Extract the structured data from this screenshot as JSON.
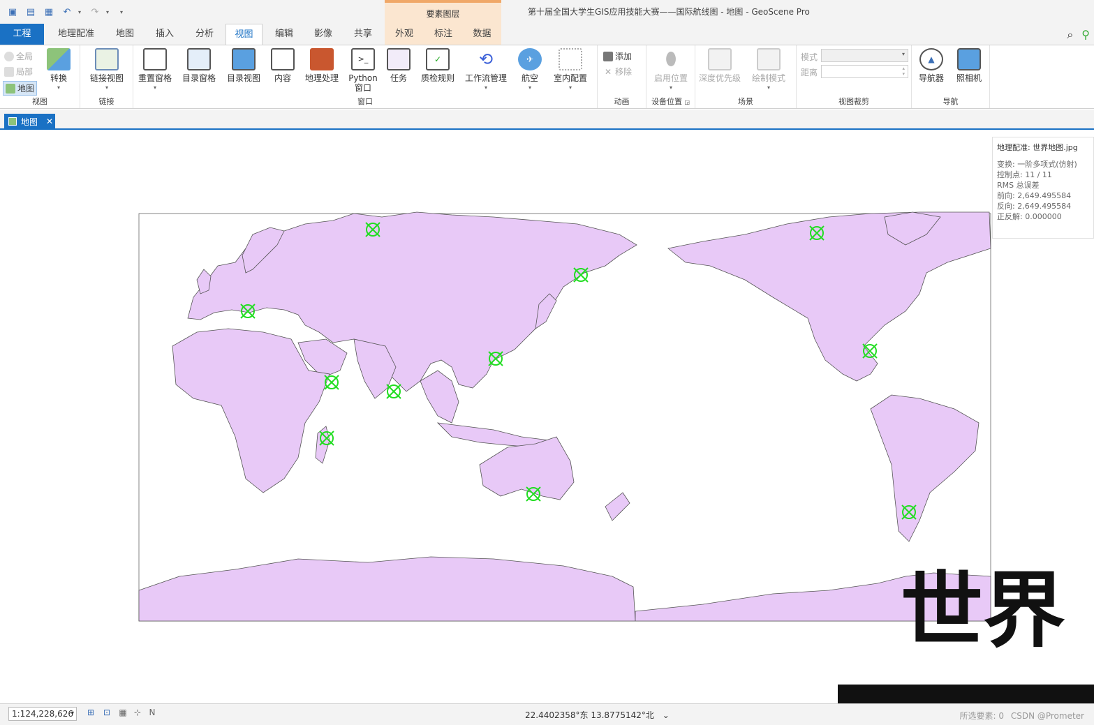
{
  "window": {
    "title": "第十届全国大学生GIS应用技能大赛——国际航线图 - 地图 - GeoScene Pro",
    "contextual_tab_group": "要素图层"
  },
  "quick_access": [
    "new-project-icon",
    "open-project-icon",
    "save-project-icon",
    "undo-icon",
    "redo-icon",
    "customize-icon"
  ],
  "tabs": [
    {
      "label": "工程"
    },
    {
      "label": "地理配准"
    },
    {
      "label": "地图"
    },
    {
      "label": "插入"
    },
    {
      "label": "分析"
    },
    {
      "label": "视图"
    },
    {
      "label": "编辑"
    },
    {
      "label": "影像"
    },
    {
      "label": "共享"
    },
    {
      "label": "外观"
    },
    {
      "label": "标注"
    },
    {
      "label": "数据"
    }
  ],
  "ribbon": {
    "view_group": {
      "label": "视图",
      "global": "全局",
      "local": "局部",
      "map": "地图",
      "convert": "转换"
    },
    "link_group": {
      "label": "链接",
      "link_views": "链接视图"
    },
    "windows_group": {
      "label": "窗口",
      "buttons": [
        "重置窗格",
        "目录窗格",
        "目录视图",
        "内容",
        "地理处理",
        "Python",
        "任务",
        "质检规则",
        "工作流管理",
        "航空",
        "室内配置"
      ],
      "python_sub": "窗口"
    },
    "animation_group": {
      "label": "动画",
      "add": "添加",
      "remove": "移除"
    },
    "device_group": {
      "label": "设备位置",
      "enable_location": "启用位置"
    },
    "scene_group": {
      "label": "场景",
      "depth_priority": "深度优先级",
      "draw_mode": "绘制模式"
    },
    "clip_group": {
      "label": "视图裁剪",
      "mode": "模式",
      "distance": "距离"
    },
    "nav_group": {
      "label": "导航",
      "navigator": "导航器",
      "camera": "照相机"
    }
  },
  "doc_tab": {
    "label": "地图"
  },
  "georef_panel": {
    "title": "地理配准: 世界地图.jpg",
    "transform": "变换:  一阶多项式(仿射)",
    "control_points": "控制点:  11 / 11",
    "rms": "RMS 总误差",
    "forward": " 前向:  2,649.495584",
    "inverse": " 反向:  2,649.495584",
    "forward_inverse": " 正反解:  0.000000"
  },
  "map_image_text": "世界",
  "status": {
    "scale": "1:124,228,626",
    "coordinates": "22.4402358°东 13.8775142°北",
    "watermark": "CSDN @Prometer",
    "selected_count": "所选要素: 0"
  },
  "colors": {
    "accent": "#1a71c4",
    "land": "#e8c9f7",
    "control_point": "#22dd22"
  }
}
